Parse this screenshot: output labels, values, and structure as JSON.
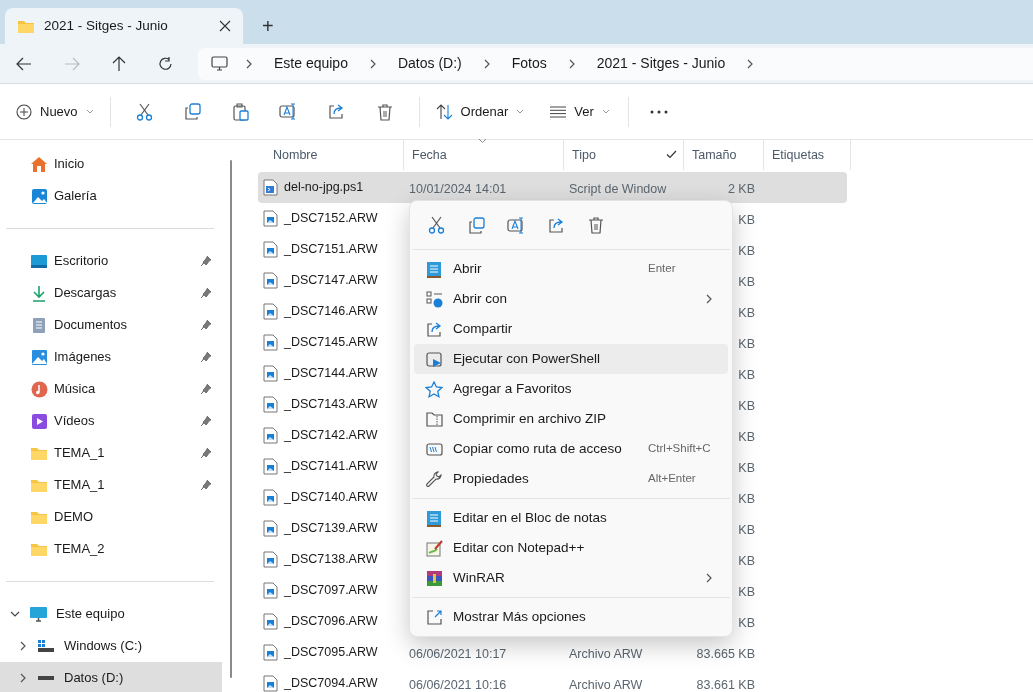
{
  "tabs": [
    {
      "title": "2021 - Sitges - Junio",
      "selected": true
    }
  ],
  "new_tab": "+",
  "nav": {
    "back_disabled": false,
    "forward_disabled": true
  },
  "breadcrumbs": [
    "Este equipo",
    "Datos (D:)",
    "Fotos",
    "2021 - Sitges - Junio"
  ],
  "toolbar": {
    "new": "Nuevo",
    "sort": "Ordenar",
    "view": "Ver"
  },
  "sidebar": {
    "quick": [
      {
        "label": "Inicio",
        "kind": "home",
        "pinned": false
      },
      {
        "label": "Galería",
        "kind": "gallery",
        "pinned": false
      }
    ],
    "pinned": [
      {
        "label": "Escritorio",
        "kind": "desktop",
        "pinned": true
      },
      {
        "label": "Descargas",
        "kind": "download",
        "pinned": true
      },
      {
        "label": "Documentos",
        "kind": "documents",
        "pinned": true
      },
      {
        "label": "Imágenes",
        "kind": "pictures",
        "pinned": true
      },
      {
        "label": "Música",
        "kind": "music",
        "pinned": true
      },
      {
        "label": "Vídeos",
        "kind": "videos",
        "pinned": true
      },
      {
        "label": "TEMA_1",
        "kind": "folder",
        "pinned": true
      },
      {
        "label": "TEMA_1",
        "kind": "folder",
        "pinned": true
      },
      {
        "label": "DEMO",
        "kind": "folder",
        "pinned": false
      },
      {
        "label": "TEMA_2",
        "kind": "folder",
        "pinned": false
      }
    ],
    "tree": [
      {
        "label": "Este equipo",
        "kind": "pc",
        "expanded": true,
        "selected": false,
        "children": [
          {
            "label": "Windows (C:)",
            "kind": "windrive",
            "expanded": false,
            "selected": false
          },
          {
            "label": "Datos (D:)",
            "kind": "drive",
            "expanded": false,
            "selected": true
          }
        ]
      }
    ]
  },
  "columns": [
    {
      "label": "Nombre",
      "sorted": false
    },
    {
      "label": "Fecha",
      "sorted": true
    },
    {
      "label": "Tipo",
      "sorted": false
    },
    {
      "label": "Tamaño",
      "sorted": false
    },
    {
      "label": "Etiquetas",
      "sorted": false
    }
  ],
  "rows": [
    {
      "name": "del-no-jpg.ps1",
      "kind": "script",
      "date": "10/01/2024 14:01",
      "type": "Script de Window",
      "size": "2 KB",
      "selected": true
    },
    {
      "name": "_DSC7152.ARW",
      "kind": "image",
      "size": "KB",
      "selected": false
    },
    {
      "name": "_DSC7151.ARW",
      "kind": "image",
      "size": "KB",
      "selected": false
    },
    {
      "name": "_DSC7147.ARW",
      "kind": "image",
      "size": "KB",
      "selected": false
    },
    {
      "name": "_DSC7146.ARW",
      "kind": "image",
      "size": "KB",
      "selected": false
    },
    {
      "name": "_DSC7145.ARW",
      "kind": "image",
      "size": "KB",
      "selected": false
    },
    {
      "name": "_DSC7144.ARW",
      "kind": "image",
      "size": "KB",
      "selected": false
    },
    {
      "name": "_DSC7143.ARW",
      "kind": "image",
      "size": "KB",
      "selected": false
    },
    {
      "name": "_DSC7142.ARW",
      "kind": "image",
      "size": "KB",
      "selected": false
    },
    {
      "name": "_DSC7141.ARW",
      "kind": "image",
      "size": "KB",
      "selected": false
    },
    {
      "name": "_DSC7140.ARW",
      "kind": "image",
      "size": "KB",
      "selected": false
    },
    {
      "name": "_DSC7139.ARW",
      "kind": "image",
      "size": "KB",
      "selected": false
    },
    {
      "name": "_DSC7138.ARW",
      "kind": "image",
      "size": "KB",
      "selected": false
    },
    {
      "name": "_DSC7097.ARW",
      "kind": "image",
      "size": "KB",
      "selected": false
    },
    {
      "name": "_DSC7096.ARW",
      "kind": "image",
      "size": "KB",
      "selected": false
    },
    {
      "name": "_DSC7095.ARW",
      "kind": "image",
      "date": "06/06/2021 10:17",
      "type": "Archivo ARW",
      "size": "83.665 KB",
      "selected": false
    },
    {
      "name": "_DSC7094.ARW",
      "kind": "image",
      "date": "06/06/2021 10:16",
      "type": "Archivo ARW",
      "size": "83.661 KB",
      "selected": false
    }
  ],
  "context_menu": {
    "groups": [
      [
        {
          "label": "Abrir",
          "kind": "notepad",
          "shortcut": "Enter",
          "submenu": false,
          "selected": false
        },
        {
          "label": "Abrir con",
          "kind": "openwith",
          "submenu": true,
          "selected": false
        },
        {
          "label": "Compartir",
          "kind": "share",
          "submenu": false,
          "selected": false
        },
        {
          "label": "Ejecutar con PowerShell",
          "kind": "run",
          "submenu": false,
          "selected": true
        },
        {
          "label": "Agregar a Favoritos",
          "kind": "star",
          "submenu": false,
          "selected": false
        },
        {
          "label": "Comprimir en archivo ZIP",
          "kind": "zip",
          "submenu": false,
          "selected": false
        },
        {
          "label": "Copiar como ruta de acceso",
          "kind": "path",
          "shortcut": "Ctrl+Shift+C",
          "submenu": false,
          "selected": false
        },
        {
          "label": "Propiedades",
          "kind": "wrench",
          "shortcut": "Alt+Enter",
          "submenu": false,
          "selected": false
        }
      ],
      [
        {
          "label": "Editar en el Bloc de notas",
          "kind": "notepad",
          "submenu": false,
          "selected": false
        },
        {
          "label": "Editar con Notepad++",
          "kind": "notepadpp",
          "submenu": false,
          "selected": false
        },
        {
          "label": "WinRAR",
          "kind": "winrar",
          "submenu": true,
          "selected": false
        }
      ],
      [
        {
          "label": "Mostrar Más opciones",
          "kind": "more",
          "submenu": false,
          "selected": false
        }
      ]
    ]
  }
}
